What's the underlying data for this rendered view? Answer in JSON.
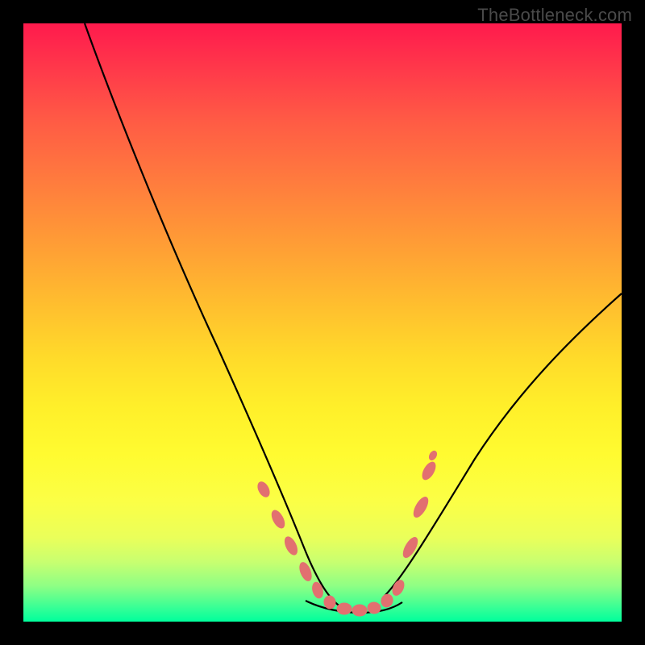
{
  "watermark": "TheBottleneck.com",
  "colors": {
    "frame": "#000000",
    "curve_stroke": "#000000",
    "marker_fill": "#e27070",
    "marker_stroke": "#e27070"
  },
  "chart_data": {
    "type": "line",
    "title": "",
    "xlabel": "",
    "ylabel": "",
    "xlim": [
      0,
      100
    ],
    "ylim": [
      0,
      100
    ],
    "series": [
      {
        "name": "left-branch",
        "x": [
          10.2,
          12,
          15,
          18,
          22,
          26,
          30,
          34,
          38,
          41,
          44,
          46,
          48,
          49.5,
          51
        ],
        "y": [
          100,
          94.5,
          86,
          77.5,
          67,
          56.5,
          46.5,
          37,
          28,
          21,
          14.5,
          10,
          6,
          3.5,
          2.5
        ]
      },
      {
        "name": "valley-floor",
        "x": [
          47,
          48.5,
          50,
          52,
          54,
          56,
          58,
          60,
          62
        ],
        "y": [
          3,
          2.2,
          1.8,
          1.6,
          1.6,
          1.7,
          2.0,
          2.5,
          3.5
        ]
      },
      {
        "name": "right-branch",
        "x": [
          60,
          63,
          67,
          72,
          78,
          84,
          90,
          95,
          100
        ],
        "y": [
          4,
          7,
          12,
          19,
          27.5,
          36,
          44,
          50,
          55
        ]
      }
    ],
    "markers": {
      "name": "highlighted-points",
      "x": [
        40,
        42.5,
        44.5,
        47,
        49,
        51,
        53.5,
        56,
        58.5,
        60.5,
        62.5,
        64.5,
        66,
        67.5
      ],
      "y": [
        22,
        17,
        12.5,
        8,
        5,
        3,
        2.3,
        2.3,
        3,
        4.2,
        6.5,
        13,
        20,
        26
      ]
    }
  }
}
